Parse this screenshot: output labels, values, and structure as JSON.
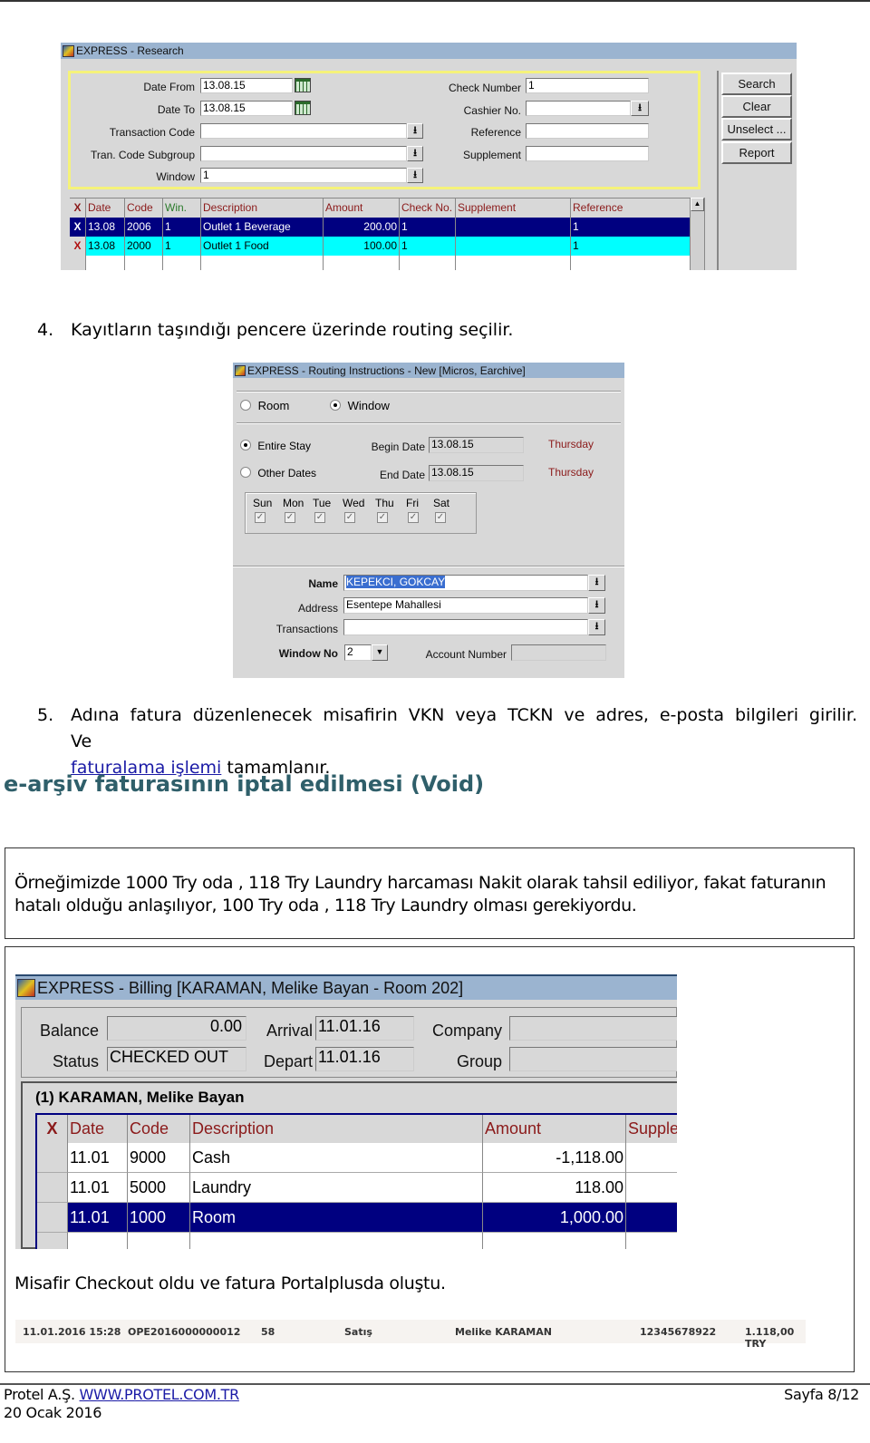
{
  "research": {
    "title": "EXPRESS - Research",
    "labels": {
      "date_from": "Date From",
      "date_to": "Date To",
      "transaction_code": "Transaction Code",
      "tran_code_subgroup": "Tran. Code Subgroup",
      "window": "Window",
      "check_number": "Check Number",
      "cashier_no": "Cashier No.",
      "reference": "Reference",
      "supplement": "Supplement"
    },
    "values": {
      "date_from": "13.08.15",
      "date_to": "13.08.15",
      "transaction_code": "",
      "tran_code_subgroup": "",
      "window": "1",
      "check_number": "1",
      "cashier_no": "",
      "reference": "",
      "supplement": ""
    },
    "buttons": {
      "search": "Search",
      "clear": "Clear",
      "unselect": "Unselect ...",
      "report": "Report"
    },
    "columns": [
      "X",
      "Date",
      "Code",
      "Win.",
      "Description",
      "Amount",
      "Check No.",
      "Supplement",
      "Reference"
    ],
    "rows": [
      {
        "x": "X",
        "date": "13.08",
        "code": "2006",
        "win": "1",
        "description": "Outlet 1 Beverage",
        "amount": "200.00",
        "check_no": "1",
        "supplement": "",
        "reference": "1",
        "state": "selected"
      },
      {
        "x": "X",
        "date": "13.08",
        "code": "2000",
        "win": "1",
        "description": "Outlet 1 Food",
        "amount": "100.00",
        "check_no": "1",
        "supplement": "",
        "reference": "1",
        "state": "marked"
      }
    ]
  },
  "step4": {
    "number": "4.",
    "text": "Kayıtların taşındığı pencere üzerinde routing seçilir."
  },
  "routing": {
    "title": "EXPRESS - Routing Instructions - New [Micros, Earchive]",
    "radio_room": "Room",
    "radio_window": "Window",
    "radio_entire_stay": "Entire Stay",
    "radio_other_dates": "Other Dates",
    "begin_date_label": "Begin Date",
    "begin_date": "13.08.15",
    "begin_day": "Thursday",
    "end_date_label": "End Date",
    "end_date": "13.08.15",
    "end_day": "Thursday",
    "days": [
      {
        "label": "Sun",
        "checked": true
      },
      {
        "label": "Mon",
        "checked": true
      },
      {
        "label": "Tue",
        "checked": true
      },
      {
        "label": "Wed",
        "checked": true
      },
      {
        "label": "Thu",
        "checked": true
      },
      {
        "label": "Fri",
        "checked": true
      },
      {
        "label": "Sat",
        "checked": true
      }
    ],
    "name_label": "Name",
    "name": "KEPEKCI, GOKCAY",
    "address_label": "Address",
    "address": "Esentepe Mahallesi",
    "transactions_label": "Transactions",
    "transactions": "",
    "window_no_label": "Window No",
    "window_no": "2",
    "account_number_label": "Account Number",
    "account_number": ""
  },
  "step5": {
    "number": "5.",
    "text_part1": "Adına fatura düzenlenecek misafirin VKN veya TCKN ve adres, e-posta bilgileri girilir. Ve",
    "link": "faturalama işlemi",
    "text_part2": " tamamlanır."
  },
  "section_heading": "e-arşiv faturasının iptal edilmesi (Void)",
  "example_box": {
    "line1": "Örneğimizde 1000 Try oda , 118 Try Laundry harcaması Nakit olarak tahsil ediliyor, fakat faturanın",
    "line2": "hatalı olduğu anlaşılıyor, 100 Try oda , 118 Try Laundry olması gerekiyordu."
  },
  "billing": {
    "title": "EXPRESS - Billing [KARAMAN, Melike Bayan - Room 202]",
    "balance_label": "Balance",
    "balance": "0.00",
    "status_label": "Status",
    "status": "CHECKED OUT",
    "arrival_label": "Arrival",
    "arrival": "11.01.16",
    "depart_label": "Depart",
    "depart": "11.01.16",
    "company_label": "Company",
    "company": "",
    "group_label": "Group",
    "group": "",
    "window_header": "(1) KARAMAN, Melike Bayan",
    "columns": [
      "X",
      "Date",
      "Code",
      "Description",
      "Amount",
      "Supple"
    ],
    "rows": [
      {
        "date": "11.01",
        "code": "9000",
        "description": "Cash",
        "amount": "-1,118.00",
        "state": "normal"
      },
      {
        "date": "11.01",
        "code": "5000",
        "description": "Laundry",
        "amount": "118.00",
        "state": "normal"
      },
      {
        "date": "11.01",
        "code": "1000",
        "description": "Room",
        "amount": "1,000.00",
        "state": "selected"
      }
    ],
    "caption": "Misafir Checkout oldu ve fatura Portalplusda oluştu.",
    "portal_row": {
      "datetime": "11.01.2016 15:28",
      "invoice_no": "OPE2016000000012",
      "number": "58",
      "type": "Satış",
      "customer": "Melike KARAMAN",
      "tax_id": "12345678922",
      "total": "1.118,00 TRY"
    }
  },
  "footer": {
    "company": "Protel A.Ş.",
    "website": "WWW.PROTEL.COM.TR",
    "date": "20 Ocak 2016",
    "page": "Sayfa 8/12"
  }
}
